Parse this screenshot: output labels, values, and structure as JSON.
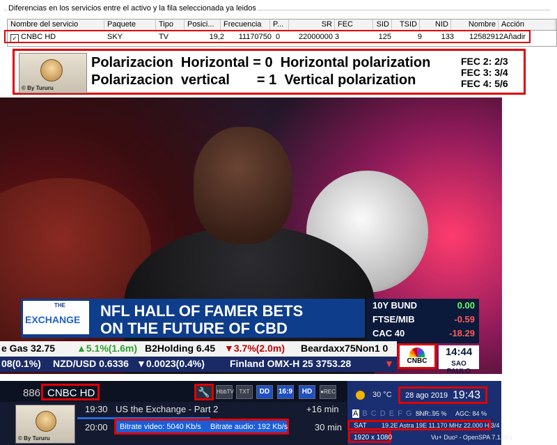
{
  "table_panel": {
    "title": "Diferencias en los servicios entre el activo y la fila seleccionada ya leidos",
    "columns": [
      "Nombre del servicio",
      "Paquete",
      "Tipo",
      "Posici...",
      "Frecuencia",
      "P...",
      "SR",
      "FEC",
      "SID",
      "TSID",
      "NID",
      "Nombre",
      "Acción"
    ],
    "row": {
      "checked": true,
      "service": "CNBC HD",
      "package": "SKY",
      "type": "TV",
      "position": "19,2",
      "frequency": "11170750",
      "p": "0",
      "sr": "22000000",
      "fec": "3",
      "sid": "125",
      "tsid": "9",
      "nid": "133",
      "name": "12582912",
      "action": "Añadir"
    }
  },
  "polarization": {
    "line1": "Polarizacion  Horizontal = 0  Horizontal polarization",
    "line2": "Polarizacion  vertical       = 1  Vertical polarization",
    "fec": [
      "FEC 2: 2/3",
      "FEC 3: 3/4",
      "FEC 4: 5/6"
    ],
    "logo_caption": "© By Tururu"
  },
  "video": {
    "exchange_the": "THE",
    "exchange_word": "EXCHANGE",
    "headline_1": "NFL HALL OF FAMER BETS",
    "headline_2": "ON THE FUTURE OF CBD",
    "markets": [
      {
        "name": "10Y BUND",
        "value": "0.00",
        "color": "#66ff66"
      },
      {
        "name": "FTSE/MIB",
        "value": "-0.59",
        "color": "#ff5a5a"
      },
      {
        "name": "CAC 40",
        "value": "-18.29",
        "color": "#ff5a5a"
      }
    ],
    "ticker_1": [
      "e Gas 32.75",
      "▲5.1%(1.6m)",
      "B2Holding 6.45",
      "▼3.7%(2.0m)",
      "Beardaxx75Non1 0"
    ],
    "ticker_2": [
      "08(0.1%)",
      "NZD/USD 0.6336",
      "▼0.0023(0.4%)",
      "Finland OMX-H 25 3753.28",
      "▼"
    ],
    "network_logo": "CNBC",
    "clock": "14:44",
    "city": "SAO PAULO"
  },
  "infobar": {
    "channel_number": "886",
    "channel_name": "CNBC HD",
    "icons": {
      "hbbtv": "HbbTV",
      "text": "TXT",
      "dolby": "DD",
      "aspect": "16:9",
      "hd": "HD",
      "rec": "●REC"
    },
    "now": {
      "time": "19:30",
      "title": "US the Exchange - Part 2",
      "remaining": "+16 min"
    },
    "next": {
      "time": "20:00",
      "duration": "30 min"
    },
    "progress": 0.5,
    "bitrate_video": "Bitrate video:  5040 Kb/s",
    "bitrate_audio": "Bitrate audio:  192 Kb/s",
    "logo_caption": "© By Tururu",
    "temperature": "30 °C",
    "date": "28 ago 2019",
    "time": "19:43",
    "tuner_letters_active": "A",
    "tuner_letters_rest": "B C D E F G H I J",
    "snr": "SNR:  95 %",
    "agc": "AGC:  84 %",
    "sat_label": "SAT",
    "sat_info": "19.2E Astra 19E 11.170 MHz 22.000 H 3/4",
    "resolution": "1920 x 1080",
    "firmware": "Vu+ Duo² - OpenSPA 7.1.001"
  }
}
